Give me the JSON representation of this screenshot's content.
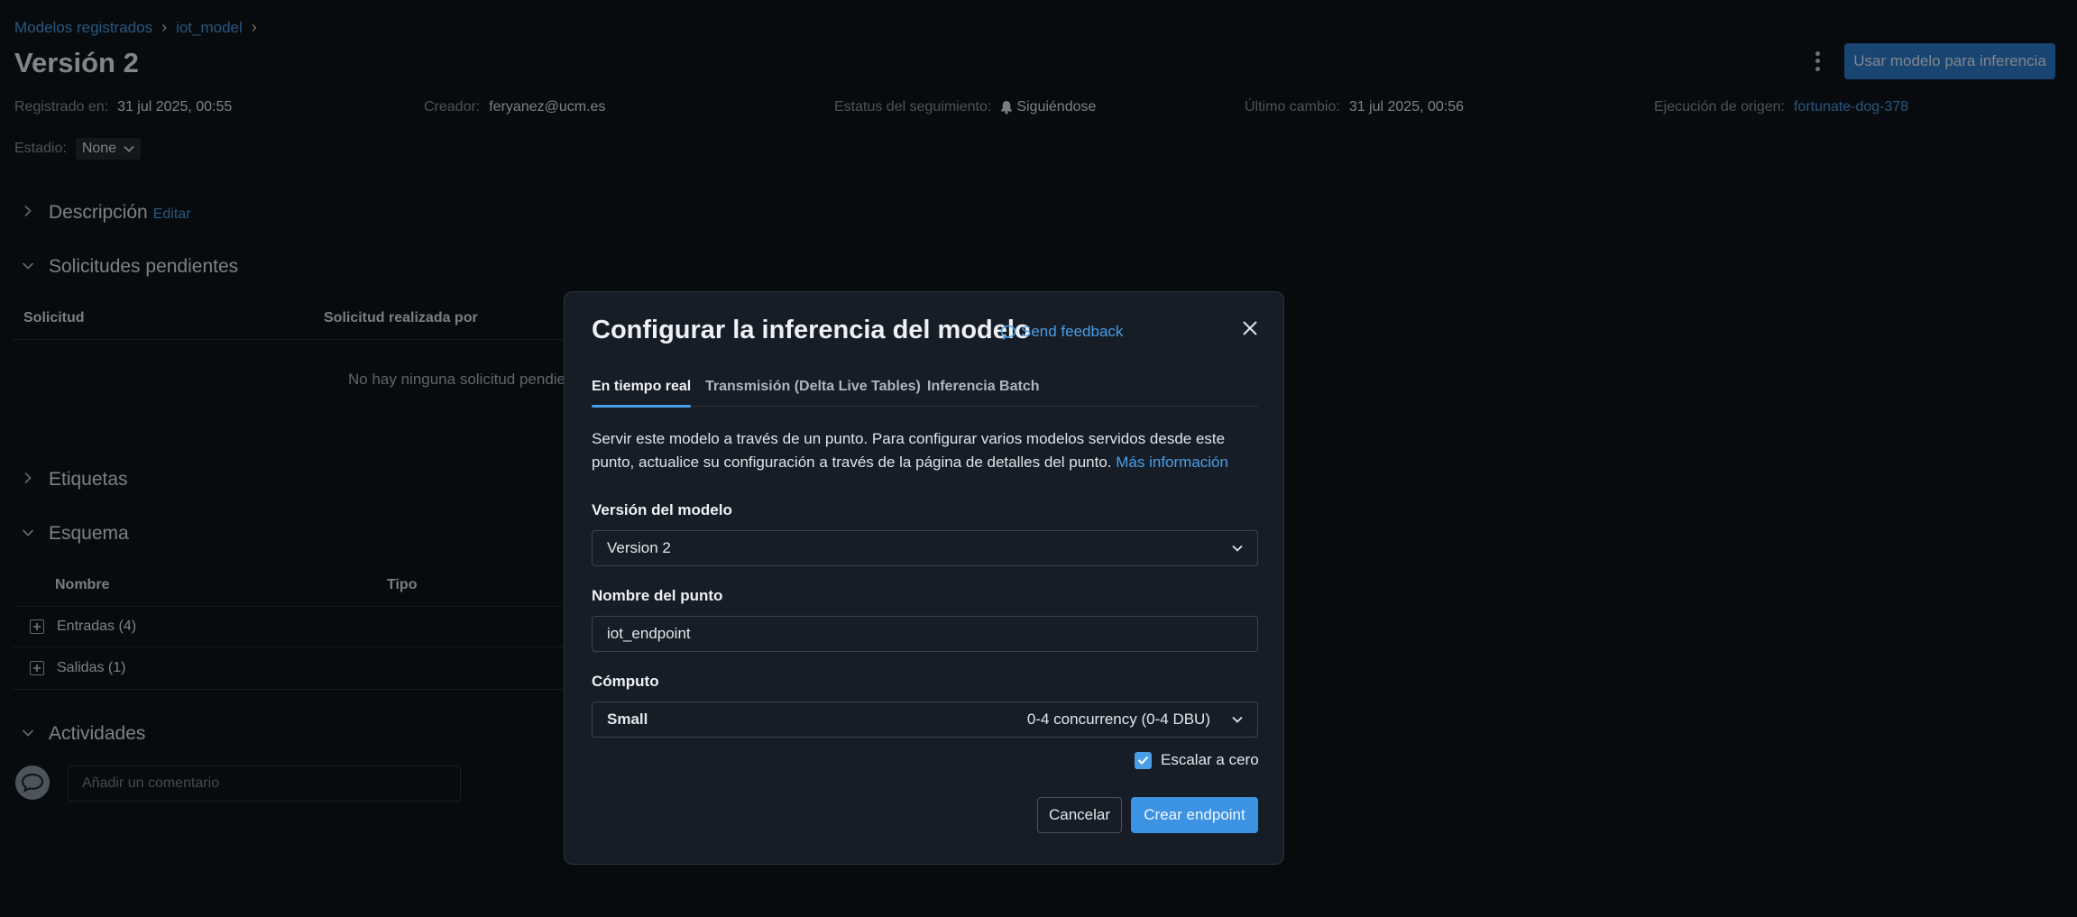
{
  "breadcrumb": {
    "item1": "Modelos registrados",
    "item2": "iot_model",
    "sep": "›"
  },
  "page": {
    "title": "Versión 2",
    "primary_button": "Usar modelo para inferencia"
  },
  "meta": {
    "registered_label": "Registrado en:",
    "registered_value": "31 jul 2025, 00:55",
    "creator_label": "Creador:",
    "creator_value": "feryanez@ucm.es",
    "tracking_label": "Estatus del seguimiento:",
    "tracking_value": "Siguiéndose",
    "last_change_label": "Último cambio:",
    "last_change_value": "31 jul 2025, 00:56",
    "source_label": "Ejecución de origen:",
    "source_value": "fortunate-dog-378",
    "stage_label": "Estadio:",
    "stage_value": "None"
  },
  "sections": {
    "description": "Descripción",
    "description_edit": "Editar",
    "pending": "Solicitudes pendientes",
    "tags": "Etiquetas",
    "schema": "Esquema",
    "activities": "Actividades"
  },
  "pending_table": {
    "col1": "Solicitud",
    "col2": "Solicitud realizada por",
    "empty": "No hay ninguna solicitud pendien"
  },
  "schema_table": {
    "col1": "Nombre",
    "col2": "Tipo",
    "rows": [
      "Entradas (4)",
      "Salidas (1)"
    ]
  },
  "comment": {
    "placeholder": "Añadir un comentario"
  },
  "modal": {
    "title": "Configurar la inferencia del modelo",
    "feedback": "Send feedback",
    "tabs": [
      "En tiempo real",
      "Transmisión (Delta Live Tables)",
      "Inferencia Batch"
    ],
    "description": "Servir este modelo a través de un punto. Para configurar varios modelos servidos desde este punto, actualice su configuración a través de la página de detalles del punto.",
    "more_info": "Más información",
    "version_label": "Versión del modelo",
    "version_value": "Version 2",
    "endpoint_label": "Nombre del punto",
    "endpoint_value": "iot_endpoint",
    "compute_label": "Cómputo",
    "compute_value": "Small",
    "compute_detail": "0-4 concurrency (0-4 DBU)",
    "scale_to_zero": "Escalar a cero",
    "cancel": "Cancelar",
    "create": "Crear endpoint"
  },
  "colors": {
    "accent": "#4a9ee8",
    "primary_button": "#3c93e3",
    "background": "#0f141b",
    "modal": "#161d26"
  }
}
